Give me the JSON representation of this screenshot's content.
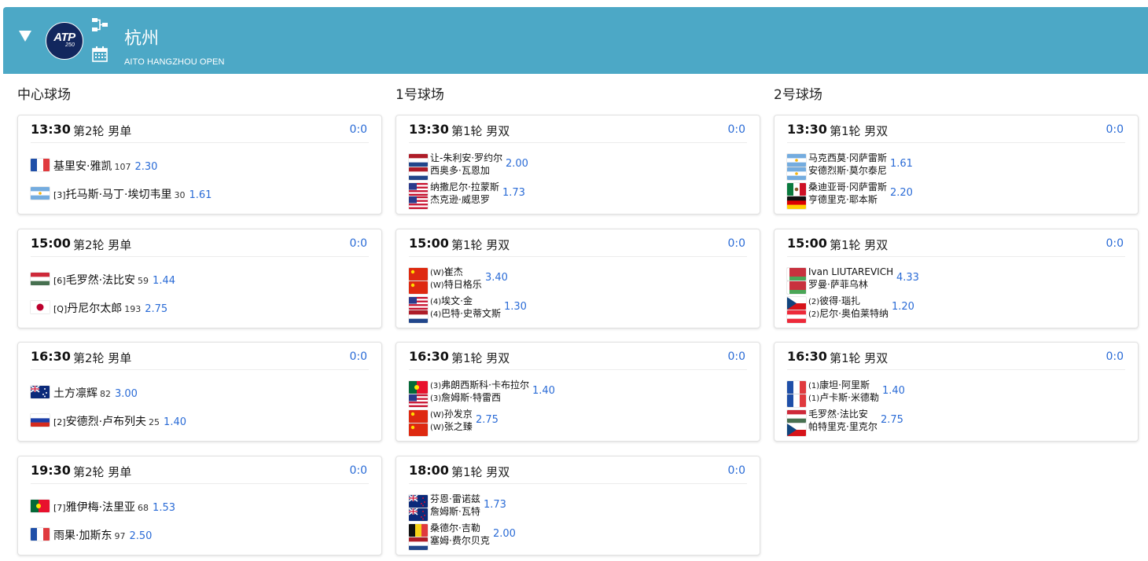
{
  "tournament": {
    "name": "杭州",
    "subtitle": "AITO HANGZHOU OPEN",
    "logo_text": "ATP",
    "logo_level": "250"
  },
  "courts": [
    {
      "title": "中心球场",
      "matches": [
        {
          "time": "13:30",
          "round": "第2轮 男单",
          "score": "0:0",
          "type": "singles",
          "players": [
            {
              "flag": "fr",
              "seed": "",
              "name": "基里安·雅凯",
              "rank": "107",
              "odds": "2.30"
            },
            {
              "flag": "ar",
              "seed": "[3]",
              "name": "托马斯·马丁·埃切韦里",
              "rank": "30",
              "odds": "1.61"
            }
          ]
        },
        {
          "time": "15:00",
          "round": "第2轮 男单",
          "score": "0:0",
          "type": "singles",
          "players": [
            {
              "flag": "hu",
              "seed": "[6]",
              "name": "毛罗然·法比安",
              "rank": "59",
              "odds": "1.44"
            },
            {
              "flag": "jp",
              "seed": "[Q]",
              "name": "丹尼尔太郎",
              "rank": "193",
              "odds": "2.75"
            }
          ]
        },
        {
          "time": "16:30",
          "round": "第2轮 男单",
          "score": "0:0",
          "type": "singles",
          "players": [
            {
              "flag": "au",
              "seed": "",
              "name": "土方凛辉",
              "rank": "82",
              "odds": "3.00"
            },
            {
              "flag": "ru",
              "seed": "[2]",
              "name": "安德烈·卢布列夫",
              "rank": "25",
              "odds": "1.40"
            }
          ]
        },
        {
          "time": "19:30",
          "round": "第2轮 男单",
          "score": "0:0",
          "type": "singles",
          "players": [
            {
              "flag": "pt",
              "seed": "[7]",
              "name": "雅伊梅·法里亚",
              "rank": "68",
              "odds": "1.53"
            },
            {
              "flag": "fr",
              "seed": "",
              "name": "雨果·加斯东",
              "rank": "97",
              "odds": "2.50"
            }
          ]
        }
      ]
    },
    {
      "title": "1号球场",
      "matches": [
        {
          "time": "13:30",
          "round": "第1轮 男双",
          "score": "0:0",
          "type": "doubles",
          "teams": [
            {
              "flags": [
                "nl",
                "nl"
              ],
              "names": [
                {
                  "seed": "",
                  "name": "让-朱利安·罗约尔"
                },
                {
                  "seed": "",
                  "name": "西奥多·瓦恩加"
                }
              ],
              "odds": "2.00"
            },
            {
              "flags": [
                "us",
                "us"
              ],
              "names": [
                {
                  "seed": "",
                  "name": "纳撒尼尔·拉蒙斯"
                },
                {
                  "seed": "",
                  "name": "杰克逊·威思罗"
                }
              ],
              "odds": "1.73"
            }
          ]
        },
        {
          "time": "15:00",
          "round": "第1轮 男双",
          "score": "0:0",
          "type": "doubles",
          "teams": [
            {
              "flags": [
                "cn",
                "cn"
              ],
              "names": [
                {
                  "seed": "(W)",
                  "name": "崔杰"
                },
                {
                  "seed": "(W)",
                  "name": "特日格乐"
                }
              ],
              "odds": "3.40"
            },
            {
              "flags": [
                "us",
                "nl"
              ],
              "names": [
                {
                  "seed": "(4)",
                  "name": "埃文·金"
                },
                {
                  "seed": "(4)",
                  "name": "巴特·史蒂文斯"
                }
              ],
              "odds": "1.30"
            }
          ]
        },
        {
          "time": "16:30",
          "round": "第1轮 男双",
          "score": "0:0",
          "type": "doubles",
          "teams": [
            {
              "flags": [
                "pt",
                "us"
              ],
              "names": [
                {
                  "seed": "(3)",
                  "name": "弗朗西斯科·卡布拉尔"
                },
                {
                  "seed": "(3)",
                  "name": "詹姆斯·特雷西"
                }
              ],
              "odds": "1.40"
            },
            {
              "flags": [
                "cn",
                "cn"
              ],
              "names": [
                {
                  "seed": "(W)",
                  "name": "孙发京"
                },
                {
                  "seed": "(W)",
                  "name": "张之臻"
                }
              ],
              "odds": "2.75"
            }
          ]
        },
        {
          "time": "18:00",
          "round": "第1轮 男双",
          "score": "0:0",
          "type": "doubles",
          "teams": [
            {
              "flags": [
                "nz",
                "nz"
              ],
              "names": [
                {
                  "seed": "",
                  "name": "芬恩·雷诺兹"
                },
                {
                  "seed": "",
                  "name": "詹姆斯·瓦特"
                }
              ],
              "odds": "1.73"
            },
            {
              "flags": [
                "be",
                "nl"
              ],
              "names": [
                {
                  "seed": "",
                  "name": "桑德尔·吉勒"
                },
                {
                  "seed": "",
                  "name": "塞姆·费尔贝克"
                }
              ],
              "odds": "2.00"
            }
          ]
        }
      ]
    },
    {
      "title": "2号球场",
      "matches": [
        {
          "time": "13:30",
          "round": "第1轮 男双",
          "score": "0:0",
          "type": "doubles",
          "teams": [
            {
              "flags": [
                "ar",
                "ar"
              ],
              "names": [
                {
                  "seed": "",
                  "name": "马克西莫·冈萨雷斯"
                },
                {
                  "seed": "",
                  "name": "安德烈斯·莫尔泰尼"
                }
              ],
              "odds": "1.61"
            },
            {
              "flags": [
                "mx",
                "de"
              ],
              "names": [
                {
                  "seed": "",
                  "name": "桑迪亚哥·冈萨雷斯"
                },
                {
                  "seed": "",
                  "name": "亨德里克·耶本斯"
                }
              ],
              "odds": "2.20"
            }
          ]
        },
        {
          "time": "15:00",
          "round": "第1轮 男双",
          "score": "0:0",
          "type": "doubles",
          "teams": [
            {
              "flags": [
                "by",
                "by"
              ],
              "names": [
                {
                  "seed": "",
                  "name": "Ivan LIUTAREVICH"
                },
                {
                  "seed": "",
                  "name": "罗曼·萨菲乌林"
                }
              ],
              "odds": "4.33"
            },
            {
              "flags": [
                "cz",
                "at"
              ],
              "names": [
                {
                  "seed": "(2)",
                  "name": "彼得·瑙扎"
                },
                {
                  "seed": "(2)",
                  "name": "尼尔·奥伯莱特纳"
                }
              ],
              "odds": "1.20"
            }
          ]
        },
        {
          "time": "16:30",
          "round": "第1轮 男双",
          "score": "0:0",
          "type": "doubles",
          "teams": [
            {
              "flags": [
                "fr",
                "fr"
              ],
              "names": [
                {
                  "seed": "(1)",
                  "name": "康坦·阿里斯"
                },
                {
                  "seed": "(1)",
                  "name": "卢卡斯·米德勒"
                }
              ],
              "odds": "1.40"
            },
            {
              "flags": [
                "hu",
                "cz"
              ],
              "names": [
                {
                  "seed": "",
                  "name": "毛罗然·法比安"
                },
                {
                  "seed": "",
                  "name": "帕特里克·里克尔"
                }
              ],
              "odds": "2.75"
            }
          ]
        }
      ]
    }
  ],
  "colors": {
    "header_bg": "#4ca8c6",
    "accent_blue": "#2a6bd6",
    "logo_navy": "#12275e"
  }
}
